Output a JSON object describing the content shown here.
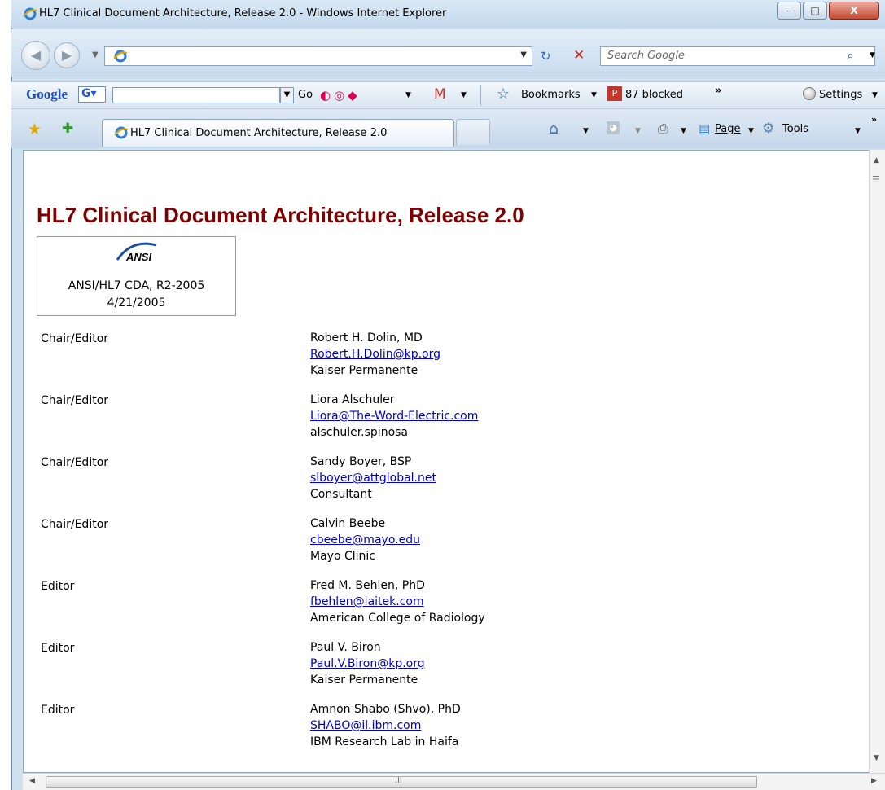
{
  "window": {
    "title": "HL7 Clinical Document Architecture, Release 2.0 - Windows Internet Explorer",
    "minimize": "–",
    "maximize": "□",
    "close": "X"
  },
  "address_bar": {
    "url": "",
    "search_placeholder": "Search Google"
  },
  "google_toolbar": {
    "logo": "Google",
    "go_label": "Go",
    "bookmarks_label": "Bookmarks",
    "blocked_label": "87 blocked",
    "settings_label": "Settings"
  },
  "tabs": [
    {
      "label": "HL7 Clinical Document Architecture, Release 2.0"
    }
  ],
  "command_bar": {
    "page_label": "Page",
    "tools_label": "Tools"
  },
  "page": {
    "title": "HL7 Clinical Document Architecture, Release 2.0",
    "logo_text": "ANSI",
    "standard": "ANSI/HL7 CDA, R2-2005",
    "date": "4/21/2005",
    "contributors": [
      {
        "role": "Chair/Editor",
        "name": "Robert H. Dolin, MD",
        "email": "Robert.H.Dolin@kp.org",
        "org": "Kaiser Permanente"
      },
      {
        "role": "Chair/Editor",
        "name": "Liora Alschuler",
        "email": "Liora@The-Word-Electric.com",
        "org": "alschuler.spinosa"
      },
      {
        "role": "Chair/Editor",
        "name": "Sandy Boyer, BSP",
        "email": "slboyer@attglobal.net",
        "org": "Consultant"
      },
      {
        "role": "Chair/Editor",
        "name": "Calvin Beebe",
        "email": "cbeebe@mayo.edu",
        "org": "Mayo Clinic"
      },
      {
        "role": "Editor",
        "name": "Fred M. Behlen, PhD",
        "email": "fbehlen@laitek.com",
        "org": "American College of Radiology"
      },
      {
        "role": "Editor",
        "name": "Paul V. Biron",
        "email": "Paul.V.Biron@kp.org",
        "org": "Kaiser Permanente"
      },
      {
        "role": "Editor",
        "name": "Amnon Shabo (Shvo), PhD",
        "email": "SHABO@il.ibm.com",
        "org": "IBM Research Lab in Haifa"
      }
    ]
  },
  "scrollbar": {
    "grip": "III"
  }
}
